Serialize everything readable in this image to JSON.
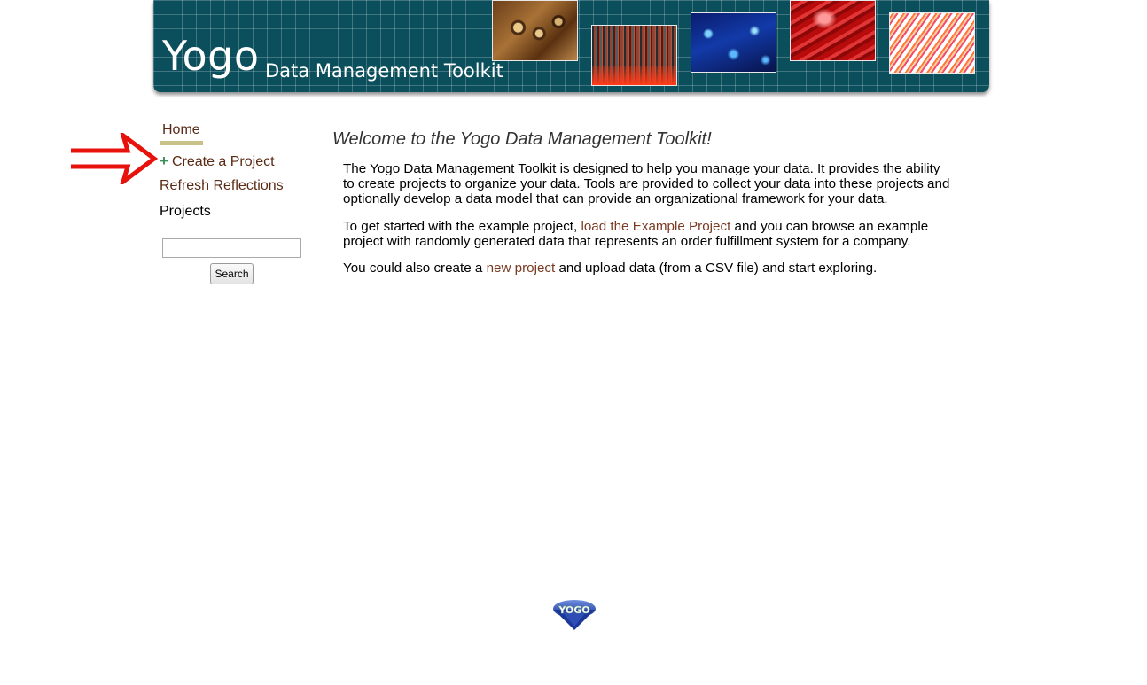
{
  "banner": {
    "logo": "Yogo",
    "subtitle": "Data Management Toolkit",
    "thumbnails": [
      "butterfly-wing-thumbnail",
      "spectrum-thumbnail",
      "circuit-board-thumbnail",
      "red-cells-thumbnail",
      "fiber-optics-thumbnail"
    ]
  },
  "sidebar": {
    "home": "Home",
    "create_project": "Create a Project",
    "refresh_reflections": "Refresh Reflections",
    "projects_label": "Projects",
    "search": {
      "value": "",
      "placeholder": "",
      "button_label": "Search"
    }
  },
  "main": {
    "title": "Welcome to the Yogo Data Management Toolkit!",
    "intro": "The Yogo Data Management Toolkit is designed to help you manage your data. It provides the ability to create projects to organize your data. Tools are provided to collect your data into these projects and optionally develop a data model that can provide an organizational framework for your data.",
    "getting_started": {
      "before": "To get started with the example project, ",
      "link": "load the Example Project",
      "after": " and you can browse an example project with randomly generated data that represents an order fulfillment system for a company."
    },
    "new_project": {
      "before": "You could also create a ",
      "link": "new project",
      "after": " and upload data (from a CSV file) and start exploring."
    }
  },
  "footer": {
    "logo_text": "YOGO"
  },
  "colors": {
    "banner": "#0c4f5c",
    "link": "#5b2a14",
    "home_underline": "#c8c28a",
    "plus": "#3a8f5a",
    "arrow": "#e8120c"
  }
}
